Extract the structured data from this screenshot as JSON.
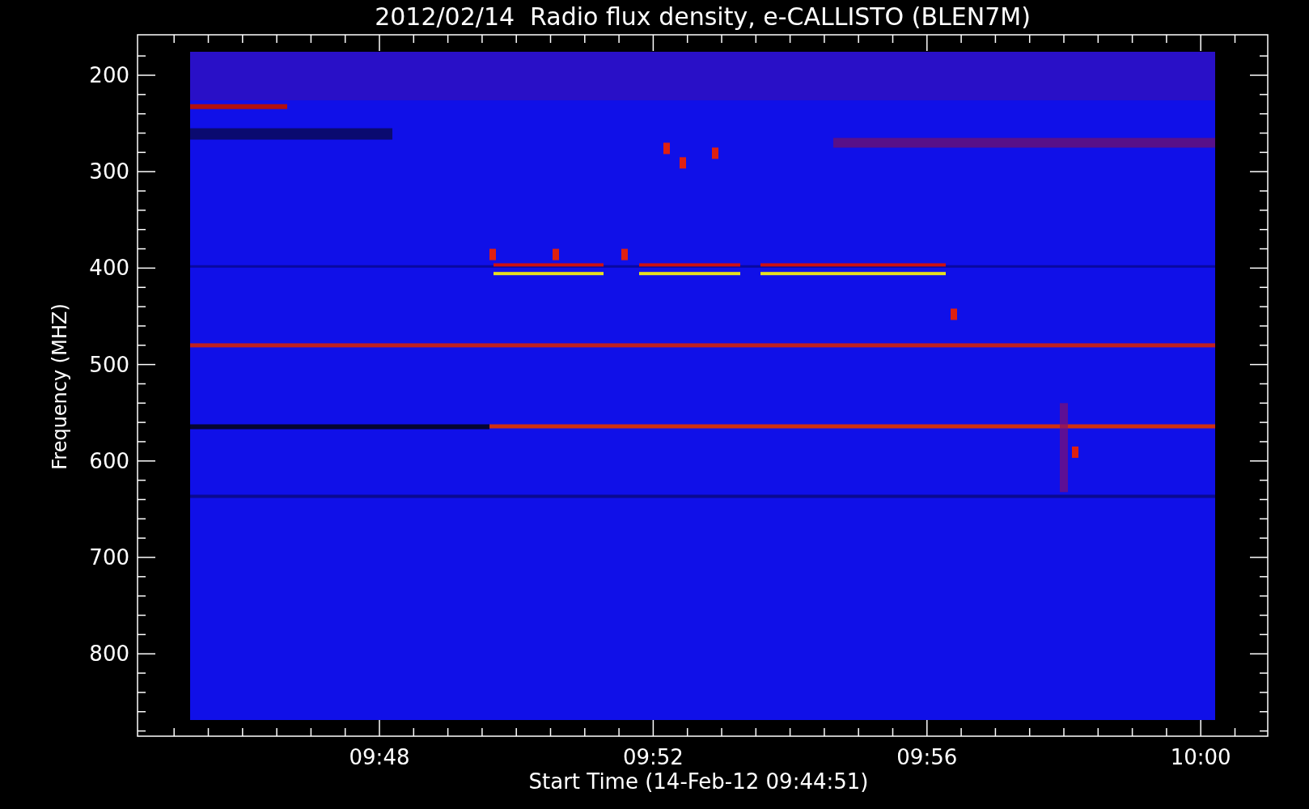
{
  "plot": {
    "title": "2012/02/14  Radio flux density, e-CALLISTO (BLEN7M)",
    "ylabel": "Frequency (MHZ)",
    "xlabel": "Start Time (14-Feb-12 09:44:51)",
    "yticks": [
      "200",
      "300",
      "400",
      "500",
      "600",
      "700",
      "800"
    ],
    "xticks": [
      "09:48",
      "09:52",
      "09:56",
      "10:00"
    ]
  }
}
